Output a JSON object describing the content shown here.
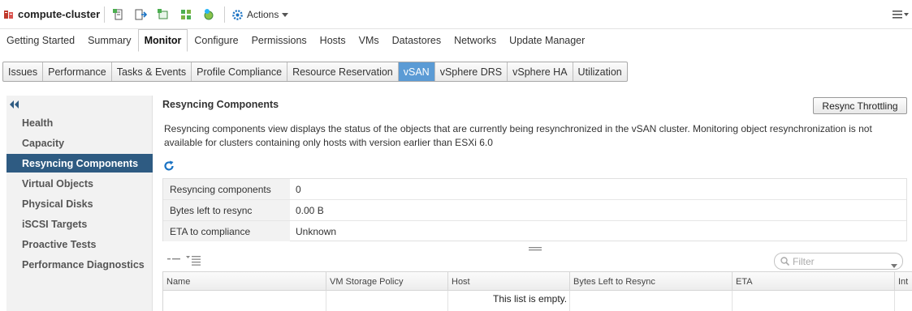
{
  "titlebar": {
    "object_name": "compute-cluster",
    "actions_label": "Actions"
  },
  "main_tabs": [
    "Getting Started",
    "Summary",
    "Monitor",
    "Configure",
    "Permissions",
    "Hosts",
    "VMs",
    "Datastores",
    "Networks",
    "Update Manager"
  ],
  "main_tab_active": "Monitor",
  "sub_tabs": [
    "Issues",
    "Performance",
    "Tasks & Events",
    "Profile Compliance",
    "Resource Reservation",
    "vSAN",
    "vSphere DRS",
    "vSphere HA",
    "Utilization"
  ],
  "sub_tab_active": "vSAN",
  "left_nav": {
    "items": [
      "Health",
      "Capacity",
      "Resyncing Components",
      "Virtual Objects",
      "Physical Disks",
      "iSCSI Targets",
      "Proactive Tests",
      "Performance Diagnostics"
    ],
    "active": "Resyncing Components"
  },
  "content": {
    "title": "Resyncing Components",
    "throttle_button": "Resync Throttling",
    "description": "Resyncing components view displays the status of the objects that are currently being resynchronized in the vSAN cluster. Monitoring object resynchronization is not available for clusters containing only hosts with version earlier than ESXi 6.0",
    "summary": [
      {
        "label": "Resyncing components",
        "value": "0"
      },
      {
        "label": "Bytes left to resync",
        "value": "0.00 B"
      },
      {
        "label": "ETA to compliance",
        "value": "Unknown"
      }
    ],
    "filter_placeholder": "Filter",
    "table": {
      "columns": [
        "Name",
        "VM Storage Policy",
        "Host",
        "Bytes Left to Resync",
        "ETA",
        "Int"
      ],
      "empty_message": "This list is empty."
    }
  },
  "colors": {
    "active_nav": "#2e5b82",
    "active_subtab": "#5b9bd5",
    "link_blue": "#1a73c4"
  }
}
